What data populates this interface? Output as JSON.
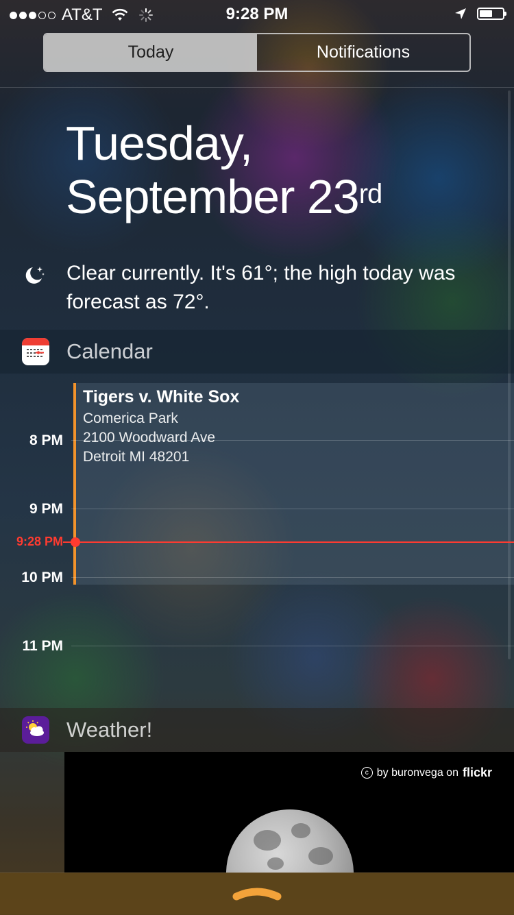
{
  "status_bar": {
    "signal_bars_filled": 3,
    "signal_bars_total": 5,
    "carrier": "AT&T",
    "time": "9:28 PM",
    "battery_level": 0.55
  },
  "tabs": [
    {
      "label": "Today",
      "selected": true
    },
    {
      "label": "Notifications",
      "selected": false
    }
  ],
  "date": {
    "line1": "Tuesday,",
    "line2": "September 23",
    "suffix": "rd"
  },
  "summary": {
    "icon": "moon-icon",
    "text": "Clear currently. It's 61°; the high today was forecast as 72°."
  },
  "calendar": {
    "header": "Calendar",
    "icon": "calendar-icon",
    "event": {
      "title": "Tigers v. White Sox",
      "location": "Comerica Park",
      "address1": "2100 Woodward Ave",
      "address2": "Detroit MI 48201"
    },
    "hours": [
      "8 PM",
      "9 PM",
      "10 PM",
      "11 PM"
    ],
    "now_label": "9:28 PM",
    "accent": "#f3932b",
    "now_color": "#ff3b30"
  },
  "weather": {
    "header": "Weather!",
    "icon": "yahoo-weather-icon",
    "credit_text": "by buronvega on",
    "credit_brand": "flickr"
  }
}
